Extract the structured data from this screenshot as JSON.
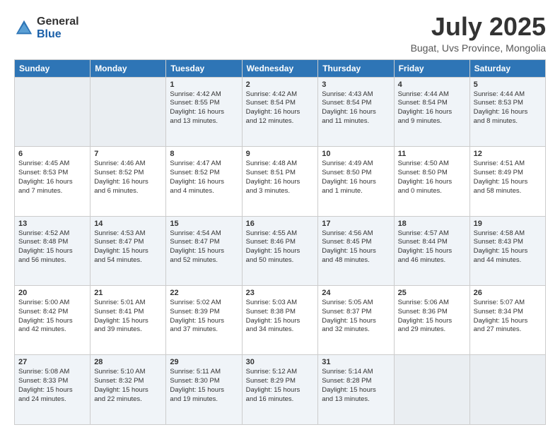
{
  "logo": {
    "general": "General",
    "blue": "Blue"
  },
  "header": {
    "month": "July 2025",
    "location": "Bugat, Uvs Province, Mongolia"
  },
  "weekdays": [
    "Sunday",
    "Monday",
    "Tuesday",
    "Wednesday",
    "Thursday",
    "Friday",
    "Saturday"
  ],
  "weeks": [
    [
      {
        "day": "",
        "lines": []
      },
      {
        "day": "",
        "lines": []
      },
      {
        "day": "1",
        "lines": [
          "Sunrise: 4:42 AM",
          "Sunset: 8:55 PM",
          "Daylight: 16 hours",
          "and 13 minutes."
        ]
      },
      {
        "day": "2",
        "lines": [
          "Sunrise: 4:42 AM",
          "Sunset: 8:54 PM",
          "Daylight: 16 hours",
          "and 12 minutes."
        ]
      },
      {
        "day": "3",
        "lines": [
          "Sunrise: 4:43 AM",
          "Sunset: 8:54 PM",
          "Daylight: 16 hours",
          "and 11 minutes."
        ]
      },
      {
        "day": "4",
        "lines": [
          "Sunrise: 4:44 AM",
          "Sunset: 8:54 PM",
          "Daylight: 16 hours",
          "and 9 minutes."
        ]
      },
      {
        "day": "5",
        "lines": [
          "Sunrise: 4:44 AM",
          "Sunset: 8:53 PM",
          "Daylight: 16 hours",
          "and 8 minutes."
        ]
      }
    ],
    [
      {
        "day": "6",
        "lines": [
          "Sunrise: 4:45 AM",
          "Sunset: 8:53 PM",
          "Daylight: 16 hours",
          "and 7 minutes."
        ]
      },
      {
        "day": "7",
        "lines": [
          "Sunrise: 4:46 AM",
          "Sunset: 8:52 PM",
          "Daylight: 16 hours",
          "and 6 minutes."
        ]
      },
      {
        "day": "8",
        "lines": [
          "Sunrise: 4:47 AM",
          "Sunset: 8:52 PM",
          "Daylight: 16 hours",
          "and 4 minutes."
        ]
      },
      {
        "day": "9",
        "lines": [
          "Sunrise: 4:48 AM",
          "Sunset: 8:51 PM",
          "Daylight: 16 hours",
          "and 3 minutes."
        ]
      },
      {
        "day": "10",
        "lines": [
          "Sunrise: 4:49 AM",
          "Sunset: 8:50 PM",
          "Daylight: 16 hours",
          "and 1 minute."
        ]
      },
      {
        "day": "11",
        "lines": [
          "Sunrise: 4:50 AM",
          "Sunset: 8:50 PM",
          "Daylight: 16 hours",
          "and 0 minutes."
        ]
      },
      {
        "day": "12",
        "lines": [
          "Sunrise: 4:51 AM",
          "Sunset: 8:49 PM",
          "Daylight: 15 hours",
          "and 58 minutes."
        ]
      }
    ],
    [
      {
        "day": "13",
        "lines": [
          "Sunrise: 4:52 AM",
          "Sunset: 8:48 PM",
          "Daylight: 15 hours",
          "and 56 minutes."
        ]
      },
      {
        "day": "14",
        "lines": [
          "Sunrise: 4:53 AM",
          "Sunset: 8:47 PM",
          "Daylight: 15 hours",
          "and 54 minutes."
        ]
      },
      {
        "day": "15",
        "lines": [
          "Sunrise: 4:54 AM",
          "Sunset: 8:47 PM",
          "Daylight: 15 hours",
          "and 52 minutes."
        ]
      },
      {
        "day": "16",
        "lines": [
          "Sunrise: 4:55 AM",
          "Sunset: 8:46 PM",
          "Daylight: 15 hours",
          "and 50 minutes."
        ]
      },
      {
        "day": "17",
        "lines": [
          "Sunrise: 4:56 AM",
          "Sunset: 8:45 PM",
          "Daylight: 15 hours",
          "and 48 minutes."
        ]
      },
      {
        "day": "18",
        "lines": [
          "Sunrise: 4:57 AM",
          "Sunset: 8:44 PM",
          "Daylight: 15 hours",
          "and 46 minutes."
        ]
      },
      {
        "day": "19",
        "lines": [
          "Sunrise: 4:58 AM",
          "Sunset: 8:43 PM",
          "Daylight: 15 hours",
          "and 44 minutes."
        ]
      }
    ],
    [
      {
        "day": "20",
        "lines": [
          "Sunrise: 5:00 AM",
          "Sunset: 8:42 PM",
          "Daylight: 15 hours",
          "and 42 minutes."
        ]
      },
      {
        "day": "21",
        "lines": [
          "Sunrise: 5:01 AM",
          "Sunset: 8:41 PM",
          "Daylight: 15 hours",
          "and 39 minutes."
        ]
      },
      {
        "day": "22",
        "lines": [
          "Sunrise: 5:02 AM",
          "Sunset: 8:39 PM",
          "Daylight: 15 hours",
          "and 37 minutes."
        ]
      },
      {
        "day": "23",
        "lines": [
          "Sunrise: 5:03 AM",
          "Sunset: 8:38 PM",
          "Daylight: 15 hours",
          "and 34 minutes."
        ]
      },
      {
        "day": "24",
        "lines": [
          "Sunrise: 5:05 AM",
          "Sunset: 8:37 PM",
          "Daylight: 15 hours",
          "and 32 minutes."
        ]
      },
      {
        "day": "25",
        "lines": [
          "Sunrise: 5:06 AM",
          "Sunset: 8:36 PM",
          "Daylight: 15 hours",
          "and 29 minutes."
        ]
      },
      {
        "day": "26",
        "lines": [
          "Sunrise: 5:07 AM",
          "Sunset: 8:34 PM",
          "Daylight: 15 hours",
          "and 27 minutes."
        ]
      }
    ],
    [
      {
        "day": "27",
        "lines": [
          "Sunrise: 5:08 AM",
          "Sunset: 8:33 PM",
          "Daylight: 15 hours",
          "and 24 minutes."
        ]
      },
      {
        "day": "28",
        "lines": [
          "Sunrise: 5:10 AM",
          "Sunset: 8:32 PM",
          "Daylight: 15 hours",
          "and 22 minutes."
        ]
      },
      {
        "day": "29",
        "lines": [
          "Sunrise: 5:11 AM",
          "Sunset: 8:30 PM",
          "Daylight: 15 hours",
          "and 19 minutes."
        ]
      },
      {
        "day": "30",
        "lines": [
          "Sunrise: 5:12 AM",
          "Sunset: 8:29 PM",
          "Daylight: 15 hours",
          "and 16 minutes."
        ]
      },
      {
        "day": "31",
        "lines": [
          "Sunrise: 5:14 AM",
          "Sunset: 8:28 PM",
          "Daylight: 15 hours",
          "and 13 minutes."
        ]
      },
      {
        "day": "",
        "lines": []
      },
      {
        "day": "",
        "lines": []
      }
    ]
  ]
}
